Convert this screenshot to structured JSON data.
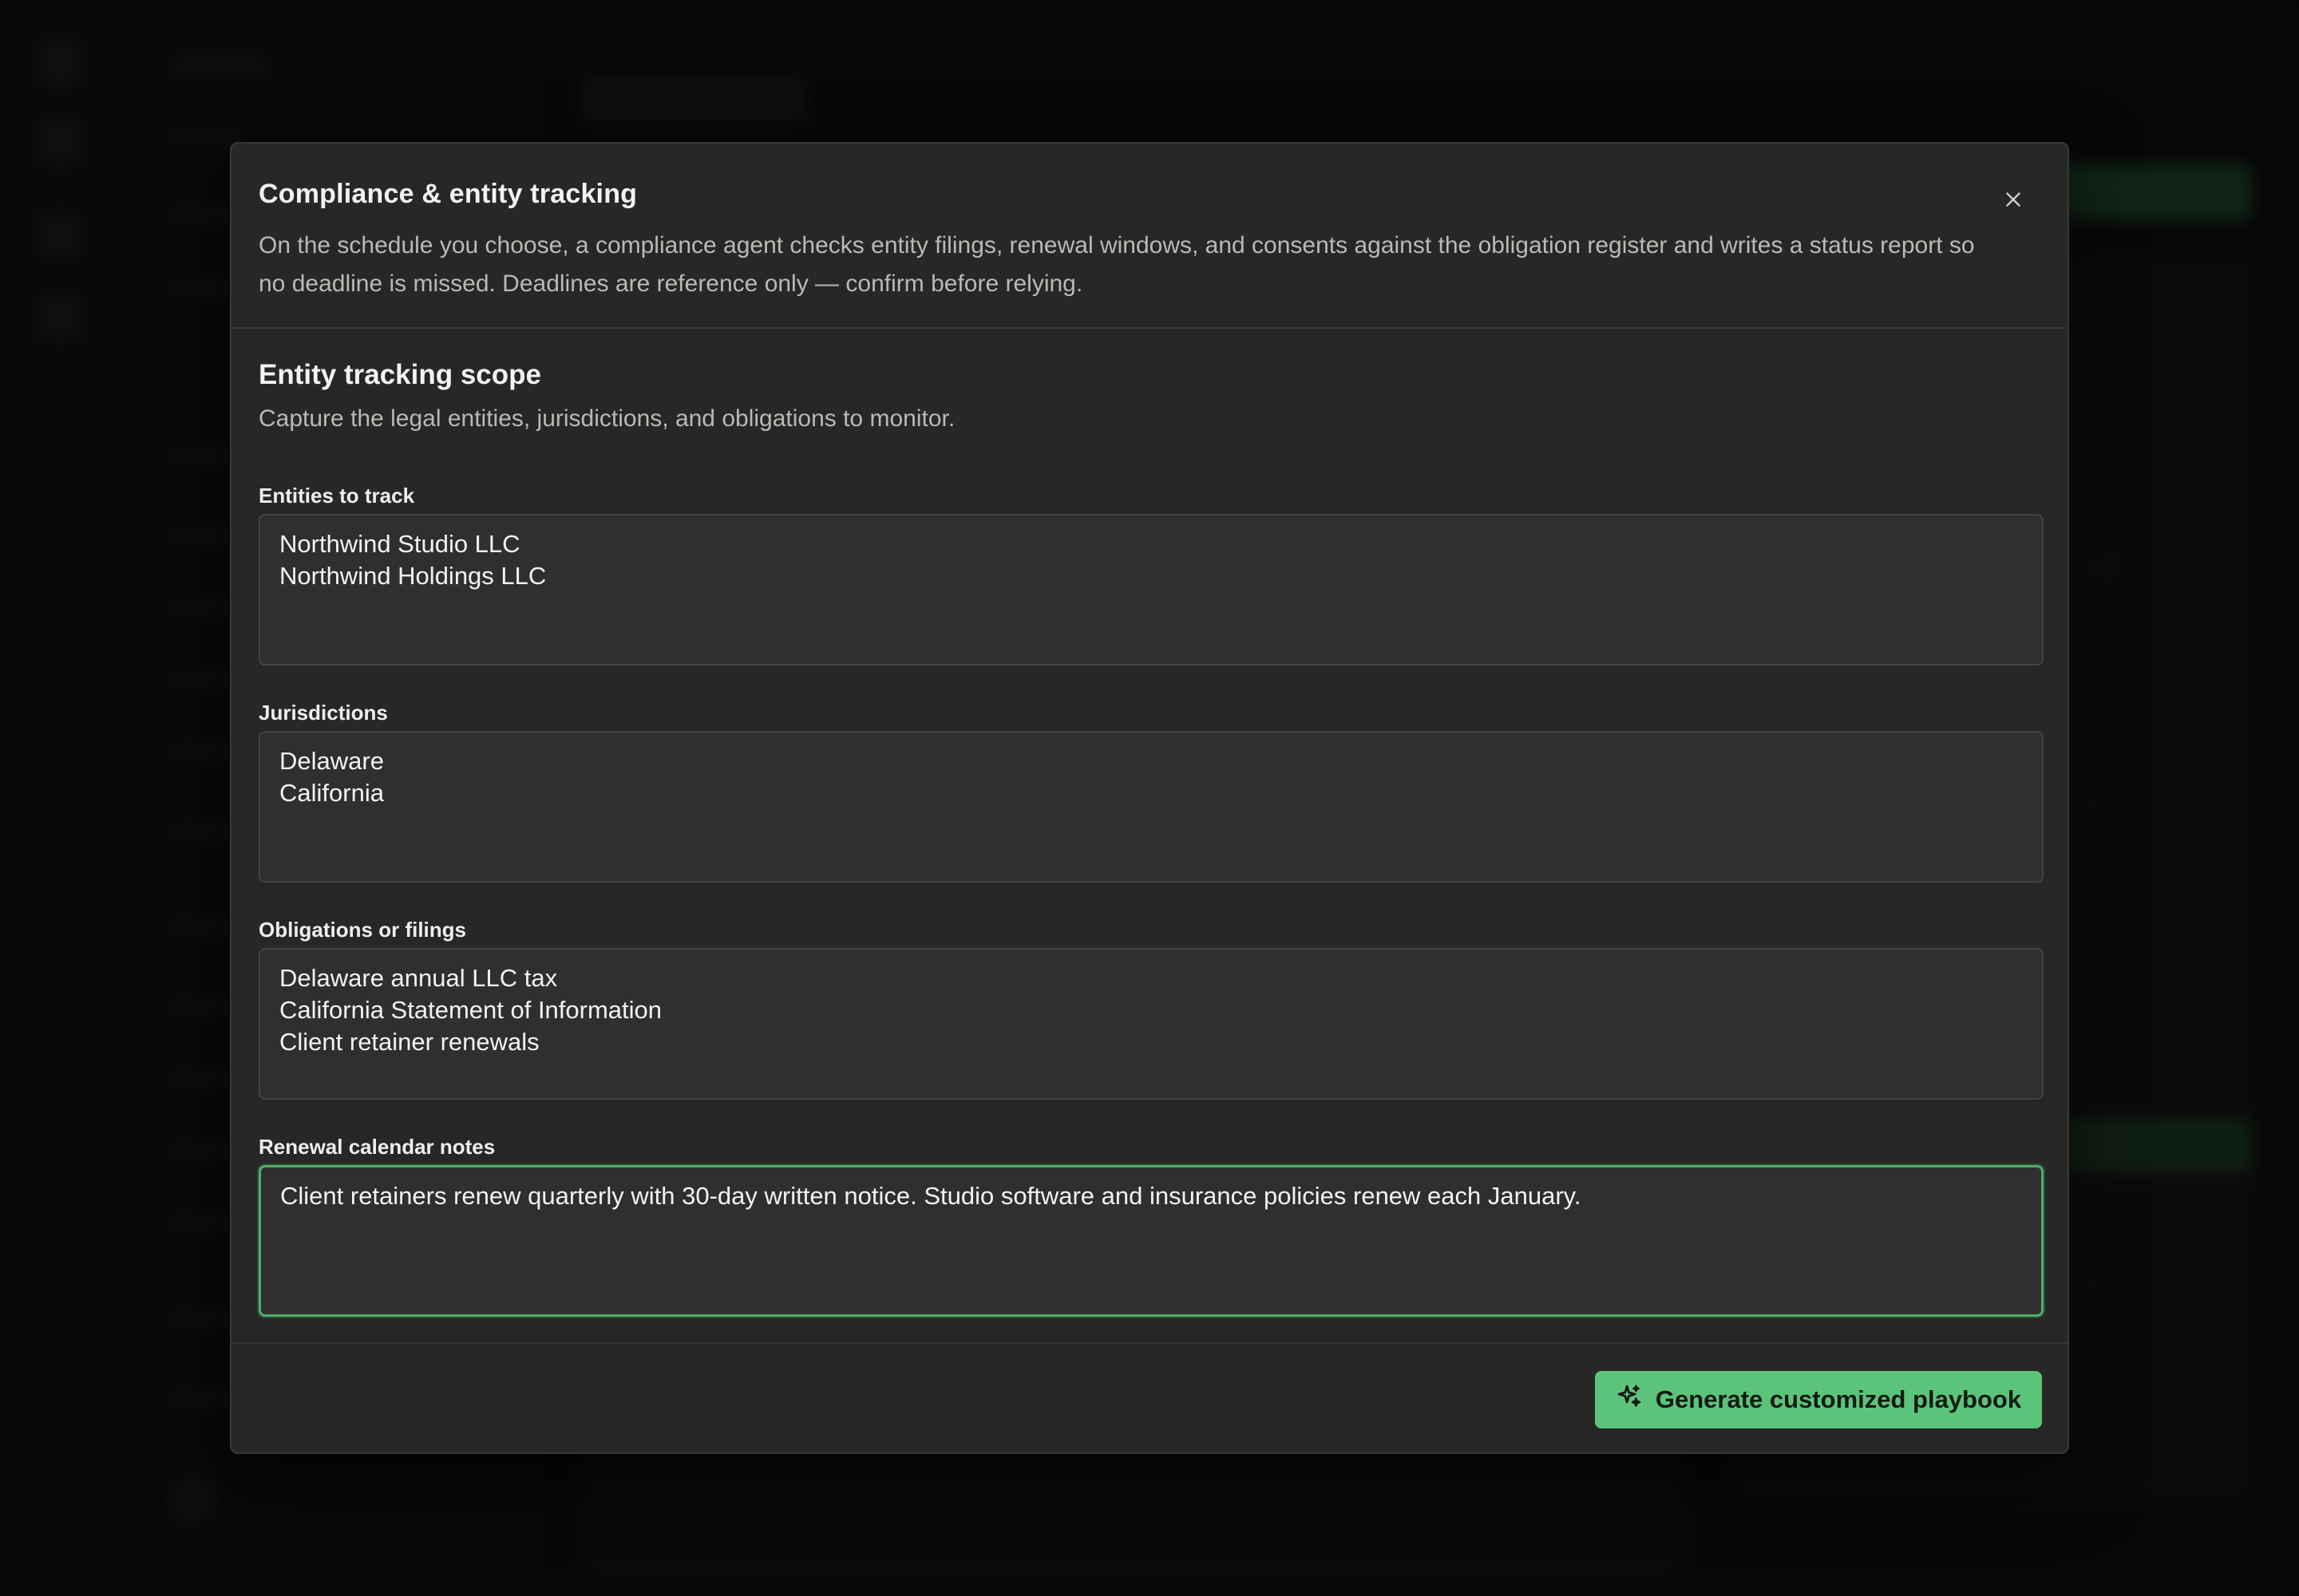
{
  "modal": {
    "title": "Compliance & entity tracking",
    "description": "On the schedule you choose, a compliance agent checks entity filings, renewal windows, and consents against the obligation register and writes a status report so no deadline is missed. Deadlines are reference only — confirm before relying.",
    "close_icon": "close-icon"
  },
  "section": {
    "title": "Entity tracking scope",
    "description": "Capture the legal entities, jurisdictions, and obligations to monitor."
  },
  "fields": {
    "entities": {
      "label": "Entities to track",
      "value": "Northwind Studio LLC\nNorthwind Holdings LLC"
    },
    "jurisdictions": {
      "label": "Jurisdictions",
      "value": "Delaware\nCalifornia"
    },
    "obligations": {
      "label": "Obligations or filings",
      "value": "Delaware annual LLC tax\nCalifornia Statement of Information\nClient retainer renewals"
    },
    "renewal_notes": {
      "label": "Renewal calendar notes",
      "value": "Client retainers renew quarterly with 30-day written notice. Studio software and insurance policies renew each January."
    }
  },
  "footer": {
    "generate_label": "Generate customized playbook",
    "generate_icon": "sparkles-icon"
  },
  "colors": {
    "accent": "#5cc47a",
    "modal_bg": "#272726",
    "field_bg": "#2f2f2e",
    "focus_border": "#4caf6a"
  }
}
